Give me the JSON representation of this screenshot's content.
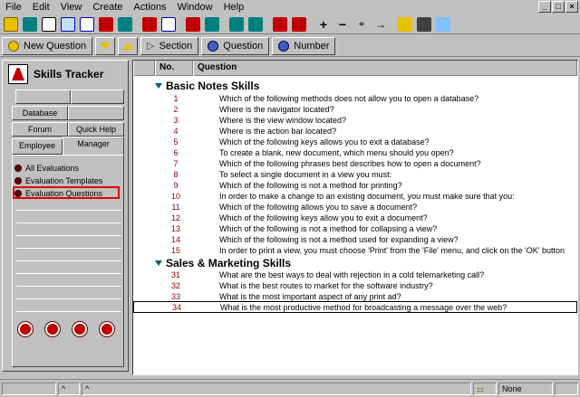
{
  "menubar": {
    "items": [
      {
        "label": "File"
      },
      {
        "label": "Edit"
      },
      {
        "label": "View"
      },
      {
        "label": "Create"
      },
      {
        "label": "Actions"
      },
      {
        "label": "Window"
      },
      {
        "label": "Help"
      }
    ],
    "window_controls": [
      "_",
      "□",
      "×"
    ]
  },
  "toolbar": {
    "icons": [
      "open-db-icon",
      "navigator-icon",
      "cut-icon",
      "copy-icon",
      "paste-icon",
      "properties-icon",
      "edit-icon",
      "print-icon",
      "back-icon",
      "forward-icon",
      "down-icon",
      "up-icon",
      "star-icon",
      "star-up-icon",
      "plus-icon",
      "minus-icon",
      "move-icon",
      "tag-icon",
      "search-icon",
      "binoculars-icon",
      "folder-icon"
    ],
    "colors": {
      "red": "#c00000",
      "teal": "#008080",
      "blue": "#0000c0",
      "yellow": "#e8c000"
    }
  },
  "actionbar": {
    "new_question": "New Question",
    "section": "Section",
    "question": "Question",
    "number": "Number"
  },
  "nav": {
    "title": "Skills Tracker",
    "tabs": {
      "database_setup": "Database Setup",
      "forum": "Forum",
      "quick_help": "Quick Help",
      "employee": "Employee",
      "manager": "Manager"
    },
    "items": [
      {
        "label": "All Evaluations"
      },
      {
        "label": "Evaluation Templates"
      },
      {
        "label": "Evaluation Questions"
      }
    ]
  },
  "table": {
    "col_no": "No.",
    "col_question": "Question",
    "categories": [
      {
        "title": "Basic Notes Skills",
        "rows": [
          {
            "no": "1",
            "q": "Which of the following methods does not allow you to open a database?"
          },
          {
            "no": "2",
            "q": "Where is the navigator located?"
          },
          {
            "no": "3",
            "q": "Where is the view window located?"
          },
          {
            "no": "4",
            "q": "Where is the action bar located?"
          },
          {
            "no": "5",
            "q": "Which of the following keys allows you to exit a database?"
          },
          {
            "no": "6",
            "q": "To create a blank, new document, which menu should you open?"
          },
          {
            "no": "7",
            "q": "Which of the following phrases best describes how to open a document?"
          },
          {
            "no": "8",
            "q": "To select a single document in a view you must:"
          },
          {
            "no": "9",
            "q": "Which of the following is not a method for printing?"
          },
          {
            "no": "10",
            "q": "In order to make a change to an existing document, you must make sure that you:"
          },
          {
            "no": "11",
            "q": "Which of the following allows you to save a document?"
          },
          {
            "no": "12",
            "q": "Which of the following keys allow you to exit a document?"
          },
          {
            "no": "13",
            "q": "Which of the following is not a method for collapsing a view?"
          },
          {
            "no": "14",
            "q": "Which of the following is not a method used for expanding a view?"
          },
          {
            "no": "15",
            "q": "In order to print a view, you must choose 'Print' from the 'File' menu, and click on the 'OK' button"
          }
        ]
      },
      {
        "title": "Sales & Marketing Skills",
        "rows": [
          {
            "no": "31",
            "q": "What are the best ways to deal with rejection in a cold telemarketing call?"
          },
          {
            "no": "32",
            "q": "What is the best routes to market for the software industry?"
          },
          {
            "no": "33",
            "q": "What is the most important aspect of any print ad?"
          },
          {
            "no": "34",
            "q": "What is the most productive method for broadcasting a message over the web?"
          }
        ]
      }
    ]
  },
  "status": {
    "location": "None"
  }
}
